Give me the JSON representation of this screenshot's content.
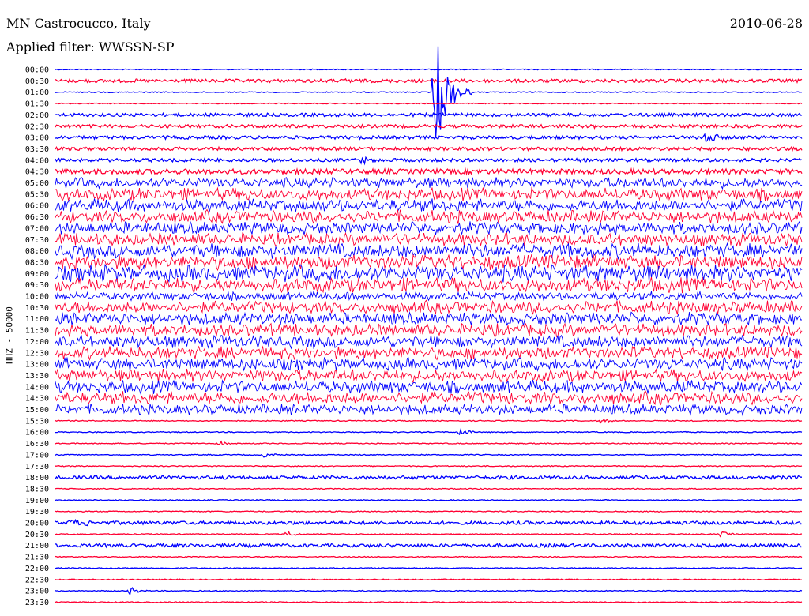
{
  "header": {
    "station": "MN Castrocucco, Italy",
    "date": "2010-06-28",
    "filter": "Applied filter: WWSSN-SP"
  },
  "axis": {
    "ylabel": "HHZ - 50000"
  },
  "chart_data": {
    "type": "line",
    "title": "MN Castrocucco, Italy",
    "subtitle": "Applied filter: WWSSN-SP",
    "ylabel": "HHZ - 50000",
    "row_labels": [
      "00:00",
      "00:30",
      "01:00",
      "01:30",
      "02:00",
      "02:30",
      "03:00",
      "03:30",
      "04:00",
      "04:30",
      "05:00",
      "05:30",
      "06:00",
      "06:30",
      "07:00",
      "07:30",
      "08:00",
      "08:30",
      "09:00",
      "09:30",
      "10:00",
      "10:30",
      "11:00",
      "11:30",
      "12:00",
      "12:30",
      "13:00",
      "13:30",
      "14:00",
      "14:30",
      "15:00",
      "15:30",
      "16:00",
      "16:30",
      "17:00",
      "17:30",
      "18:00",
      "18:30",
      "19:00",
      "19:30",
      "20:00",
      "20:30",
      "21:00",
      "21:30",
      "22:00",
      "22:30",
      "23:00",
      "23:30"
    ],
    "trace_colors": [
      "#0000ff",
      "#ff0033"
    ],
    "row_noise_level": [
      1,
      2,
      1,
      1,
      2,
      2,
      2,
      2,
      2,
      3,
      5,
      6,
      6,
      6,
      6,
      6,
      7,
      7,
      8,
      7,
      4,
      6,
      6,
      6,
      6,
      6,
      6,
      6,
      6,
      6,
      5,
      1,
      1,
      1,
      1,
      1,
      2,
      1,
      1,
      1,
      2,
      1,
      2,
      1,
      1,
      1,
      1,
      1
    ],
    "events": [
      {
        "row": 1,
        "x_frac": 0.11,
        "amp": 3
      },
      {
        "row": 1,
        "x_frac": 0.39,
        "amp": 5
      },
      {
        "row": 5,
        "x_frac": 0.5,
        "amp": 3
      },
      {
        "row": 5,
        "x_frac": 0.72,
        "amp": 3
      },
      {
        "row": 6,
        "x_frac": 0.87,
        "amp": 12
      },
      {
        "row": 8,
        "x_frac": 0.41,
        "amp": 6
      },
      {
        "row": 8,
        "x_frac": 0.88,
        "amp": 4
      },
      {
        "row": 30,
        "x_frac": 0.06,
        "amp": 8
      },
      {
        "row": 30,
        "x_frac": 0.33,
        "amp": 8
      },
      {
        "row": 31,
        "x_frac": 0.73,
        "amp": 3
      },
      {
        "row": 32,
        "x_frac": 0.54,
        "amp": 5
      },
      {
        "row": 33,
        "x_frac": 0.22,
        "amp": 3
      },
      {
        "row": 34,
        "x_frac": 0.28,
        "amp": 4
      },
      {
        "row": 40,
        "x_frac": 0.02,
        "amp": 7
      },
      {
        "row": 40,
        "x_frac": 0.04,
        "amp": 5
      },
      {
        "row": 41,
        "x_frac": 0.31,
        "amp": 4
      },
      {
        "row": 41,
        "x_frac": 0.89,
        "amp": 4
      },
      {
        "row": 46,
        "x_frac": 0.1,
        "amp": 5
      }
    ],
    "main_event": {
      "row": 2,
      "x_frac": 0.506,
      "peak_amp": 90
    }
  }
}
